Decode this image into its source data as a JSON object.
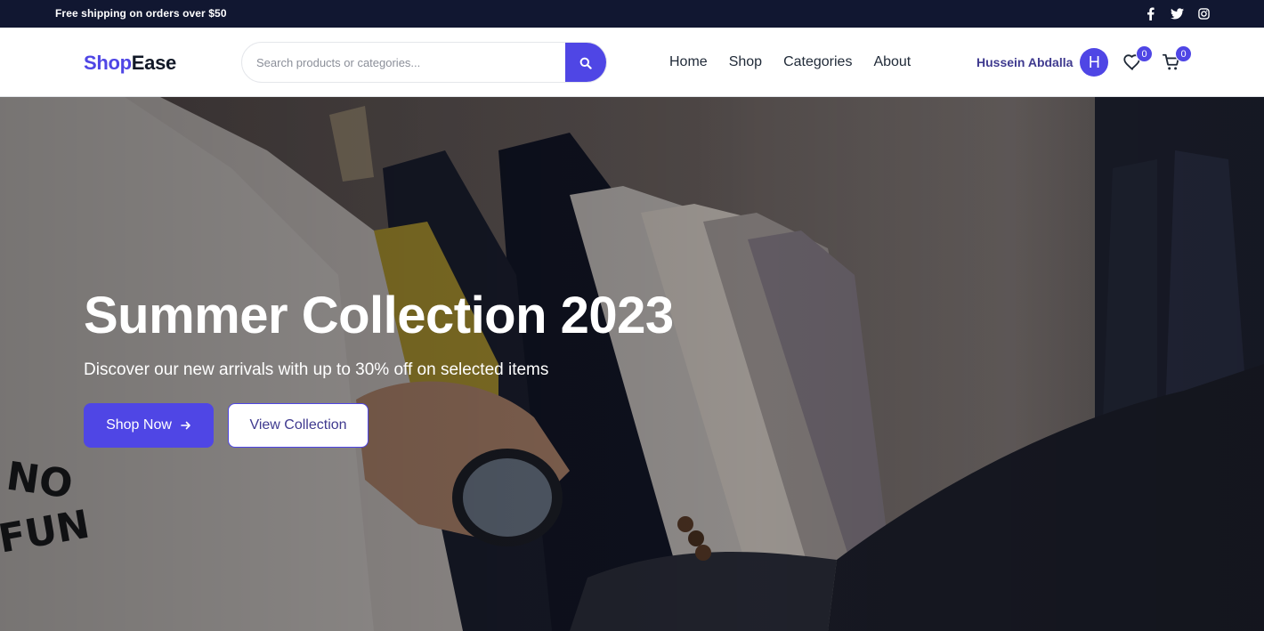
{
  "topbar": {
    "promo": "Free shipping on orders over $50",
    "socials": [
      {
        "name": "facebook-icon",
        "glyph": "f"
      },
      {
        "name": "twitter-icon"
      },
      {
        "name": "instagram-icon"
      }
    ]
  },
  "header": {
    "logo_part1": "Shop",
    "logo_part2": "Ease",
    "search": {
      "placeholder": "Search products or categories...",
      "value": ""
    },
    "nav": [
      "Home",
      "Shop",
      "Categories",
      "About"
    ],
    "user": {
      "name": "Hussein Abdalla",
      "initial": "H"
    },
    "wishlist_count": "0",
    "cart_count": "0"
  },
  "hero": {
    "title": "Summer Collection 2023",
    "subtitle": "Discover our new arrivals with up to 30% off on selected items",
    "primary_label": "Shop Now",
    "secondary_label": "View Collection"
  },
  "colors": {
    "accent": "#4f46e5",
    "topbar": "#111731"
  }
}
